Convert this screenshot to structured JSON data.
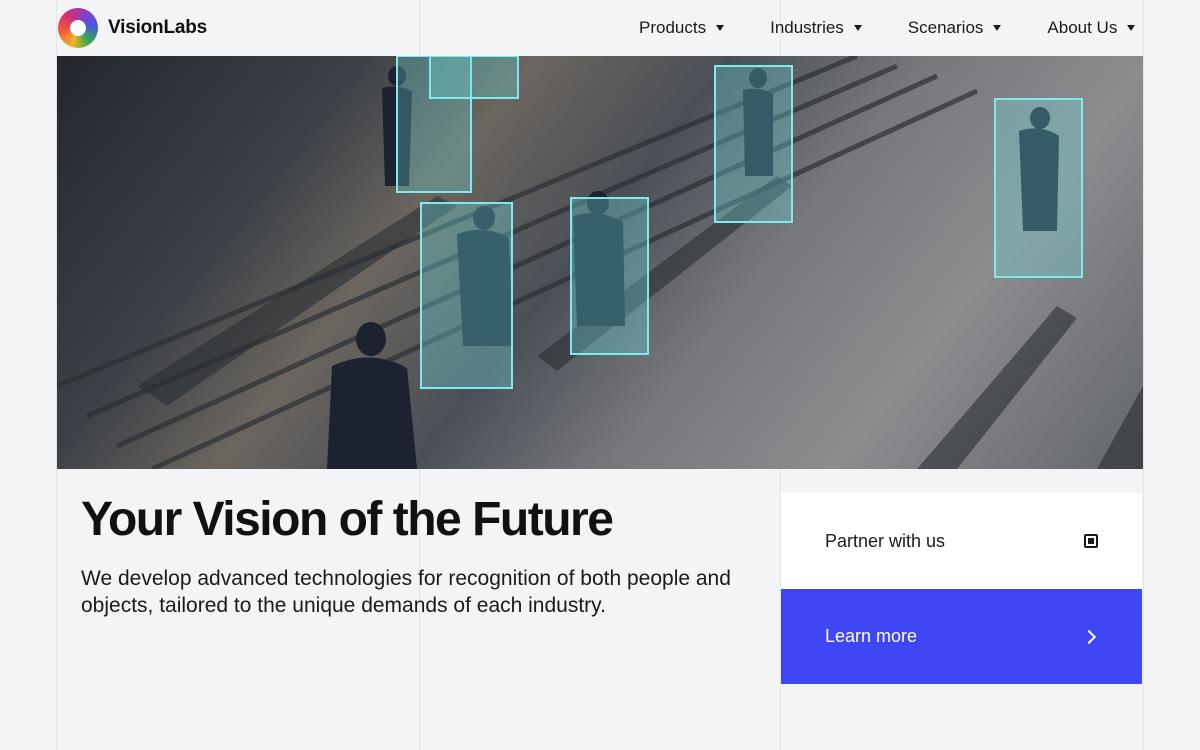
{
  "brand": {
    "name": "VisionLabs"
  },
  "nav": {
    "items": [
      {
        "label": "Products"
      },
      {
        "label": "Industries"
      },
      {
        "label": "Scenarios"
      },
      {
        "label": "About Us"
      }
    ]
  },
  "hero": {
    "title": "Your Vision of the Future",
    "description": "We develop advanced technologies for recognition of both people and objects, tailored to the unique demands of each industry."
  },
  "cards": {
    "partner_label": "Partner with us",
    "learn_label": "Learn more"
  },
  "colors": {
    "accent": "#3f47f4",
    "detection_box": "#6ee6e6",
    "background": "#f3f4f6"
  },
  "icons": {
    "partner": "target-icon",
    "learn": "arrow-right-icon",
    "nav_dropdown": "chevron-down-icon"
  }
}
